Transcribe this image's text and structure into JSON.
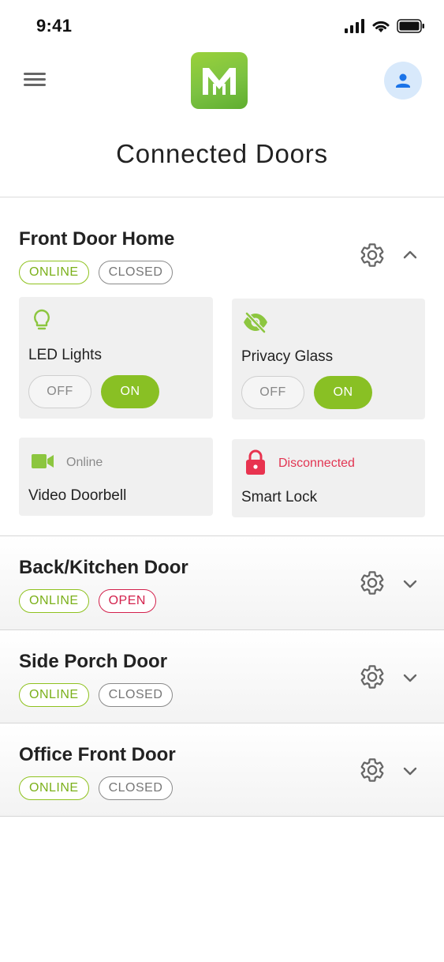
{
  "status_bar": {
    "time": "9:41"
  },
  "header": {
    "title": "Connected Doors"
  },
  "colors": {
    "brand_green": "#8fc21f",
    "alert_red": "#d3214c",
    "avatar_bg": "#d8e9fb",
    "avatar_icon": "#1a73e8"
  },
  "doors": [
    {
      "name": "Front Door Home",
      "status": "ONLINE",
      "state": "CLOSED",
      "expanded": true,
      "devices": [
        {
          "name": "LED Lights",
          "icon": "lightbulb-icon",
          "toggle": {
            "off_label": "OFF",
            "on_label": "ON",
            "value": "ON"
          }
        },
        {
          "name": "Privacy Glass",
          "icon": "eye-off-icon",
          "toggle": {
            "off_label": "OFF",
            "on_label": "ON",
            "value": "ON"
          }
        },
        {
          "name": "Video Doorbell",
          "icon": "video-camera-icon",
          "status": "Online"
        },
        {
          "name": "Smart Lock",
          "icon": "lock-icon",
          "status": "Disconnected"
        }
      ]
    },
    {
      "name": "Back/Kitchen Door",
      "status": "ONLINE",
      "state": "OPEN",
      "expanded": false
    },
    {
      "name": "Side Porch Door",
      "status": "ONLINE",
      "state": "CLOSED",
      "expanded": false
    },
    {
      "name": "Office Front Door",
      "status": "ONLINE",
      "state": "CLOSED",
      "expanded": false
    }
  ]
}
